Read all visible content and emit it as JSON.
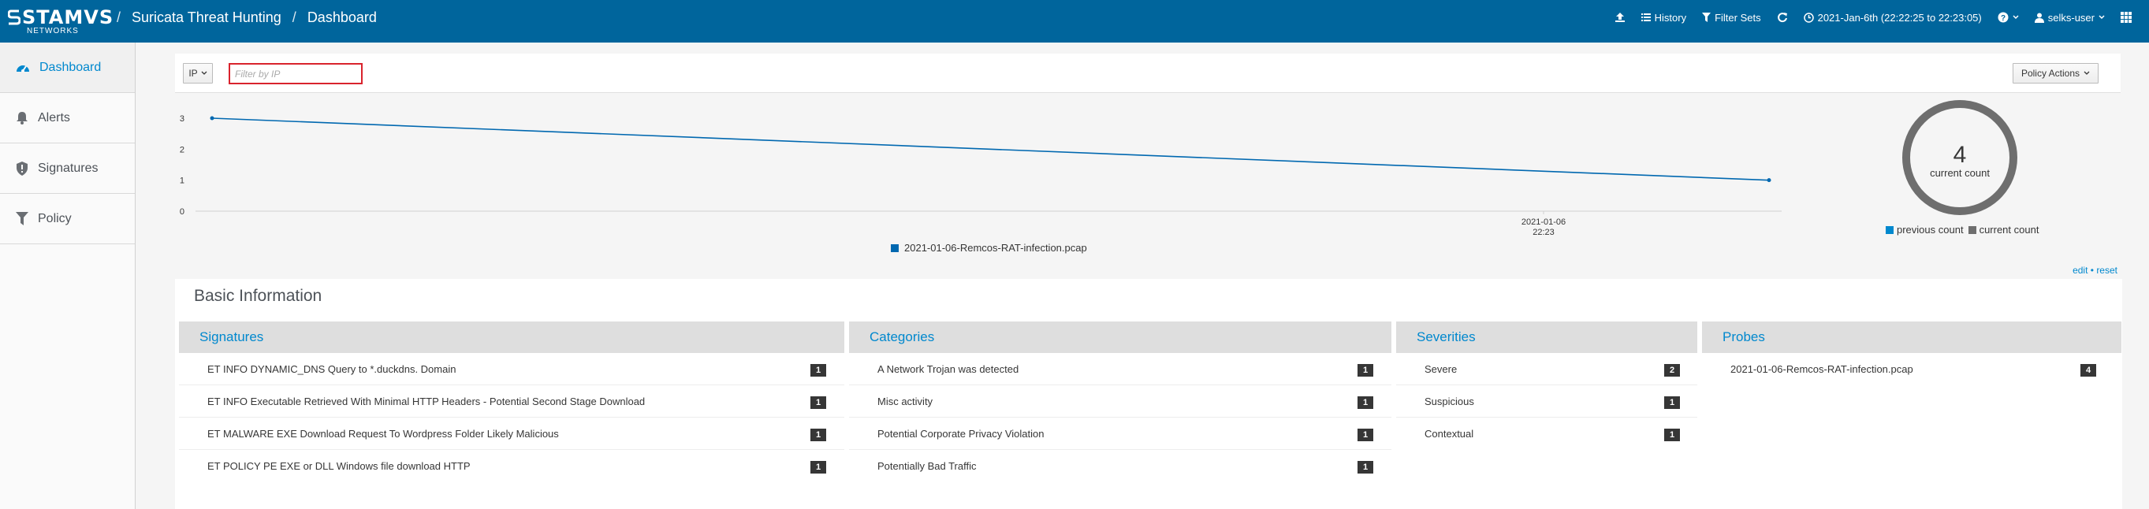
{
  "brand": {
    "name": "STAMVS",
    "sub": "NETWORKS"
  },
  "breadcrumb": {
    "app": "Suricata Threat Hunting",
    "page": "Dashboard",
    "separator": "/"
  },
  "topbar": {
    "history_label": "History",
    "filter_sets_label": "Filter Sets",
    "time_range": "2021-Jan-6th (22:22:25 to 22:23:05)",
    "user": "selks-user"
  },
  "sidebar": {
    "items": [
      {
        "label": "Dashboard",
        "icon": "dashboard-icon",
        "active": true
      },
      {
        "label": "Alerts",
        "icon": "bell-icon",
        "active": false
      },
      {
        "label": "Signatures",
        "icon": "shield-icon",
        "active": false
      },
      {
        "label": "Policy",
        "icon": "filter-icon",
        "active": false
      }
    ]
  },
  "filter": {
    "field": "IP",
    "placeholder": "Filter by IP",
    "policy_actions": "Policy Actions"
  },
  "chart_data": [
    {
      "type": "line",
      "x": [
        "2021-01-06 22:22:25",
        "2021-01-06 22:23:05"
      ],
      "series": [
        {
          "name": "2021-01-06-Remcos-RAT-infection.pcap",
          "values": [
            3,
            1
          ],
          "color": "#0068b0"
        }
      ],
      "y_ticks": [
        "0",
        "1",
        "2",
        "3"
      ],
      "x_tick_label": [
        "2021-01-06",
        "22:23"
      ],
      "ylim": [
        0,
        3
      ],
      "legend_position": "bottom-center"
    },
    {
      "type": "pie",
      "style": "donut",
      "center_value": "4",
      "center_label": "current count",
      "series": [
        {
          "name": "previous count",
          "value": 0,
          "color": "#0088ce"
        },
        {
          "name": "current count",
          "value": 4,
          "color": "#6e6e6e"
        }
      ],
      "legend_position": "bottom"
    }
  ],
  "edit_reset": {
    "edit": "edit",
    "dot": "•",
    "reset": "reset"
  },
  "basic_information": {
    "title": "Basic Information",
    "signatures": {
      "title": "Signatures",
      "rows": [
        {
          "label": "ET INFO DYNAMIC_DNS Query to *.duckdns. Domain",
          "count": "1"
        },
        {
          "label": "ET INFO Executable Retrieved With Minimal HTTP Headers - Potential Second Stage Download",
          "count": "1"
        },
        {
          "label": "ET MALWARE EXE Download Request To Wordpress Folder Likely Malicious",
          "count": "1"
        },
        {
          "label": "ET POLICY PE EXE or DLL Windows file download HTTP",
          "count": "1"
        }
      ]
    },
    "categories": {
      "title": "Categories",
      "rows": [
        {
          "label": "A Network Trojan was detected",
          "count": "1"
        },
        {
          "label": "Misc activity",
          "count": "1"
        },
        {
          "label": "Potential Corporate Privacy Violation",
          "count": "1"
        },
        {
          "label": "Potentially Bad Traffic",
          "count": "1"
        }
      ]
    },
    "severities": {
      "title": "Severities",
      "rows": [
        {
          "label": "Severe",
          "count": "2"
        },
        {
          "label": "Suspicious",
          "count": "1"
        },
        {
          "label": "Contextual",
          "count": "1"
        }
      ]
    },
    "probes": {
      "title": "Probes",
      "rows": [
        {
          "label": "2021-01-06-Remcos-RAT-infection.pcap",
          "count": "4"
        }
      ]
    }
  }
}
